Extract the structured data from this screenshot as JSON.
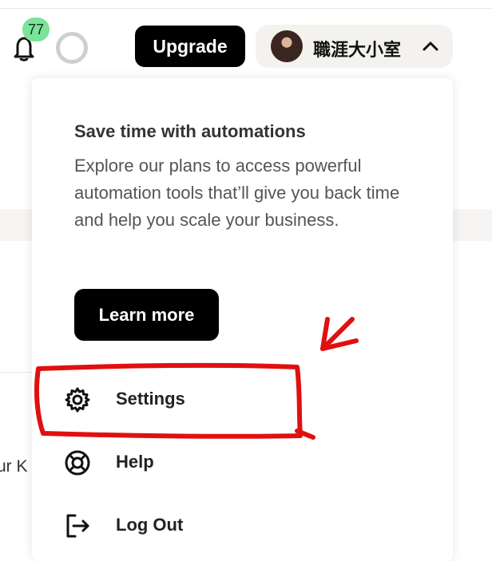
{
  "header": {
    "notification_count": "77",
    "upgrade_label": "Upgrade",
    "profile_name": "職涯大小室"
  },
  "background": {
    "partial_text": "ur K"
  },
  "dropdown": {
    "promo": {
      "title": "Save time with automations",
      "text": "Explore our plans to access powerful automation tools that’ll give you back time and help you scale your business.",
      "learn_more_label": "Learn more"
    },
    "menu": [
      {
        "label": "Settings",
        "icon": "gear-icon"
      },
      {
        "label": "Help",
        "icon": "lifebuoy-icon"
      },
      {
        "label": "Log Out",
        "icon": "logout-icon"
      }
    ]
  },
  "annotation": {
    "color": "#e01010",
    "shape": "hand-drawn box and arrow around Settings"
  },
  "colors": {
    "badge": "#7be39a",
    "button": "#000000",
    "profile_bg": "#f3f2ee"
  }
}
